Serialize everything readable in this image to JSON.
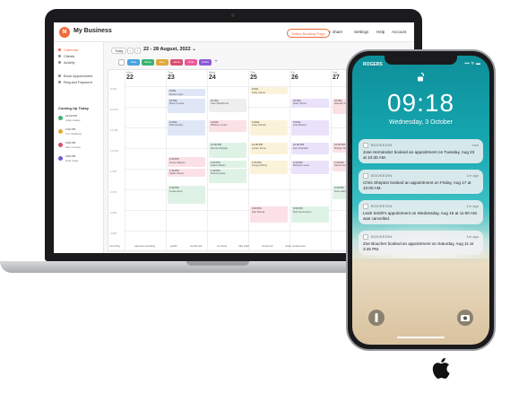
{
  "app": {
    "business_name": "My Business",
    "logo_letter": "M",
    "book_button": "Online Booking Page",
    "share_label": "< share",
    "header_links": [
      "Settings",
      "Help",
      "Account"
    ]
  },
  "sidebar": {
    "items": [
      {
        "label": "Calendar",
        "active": true
      },
      {
        "label": "Clients",
        "active": false
      },
      {
        "label": "Activity",
        "active": false
      },
      {
        "label": "Book Appointment",
        "active": false
      },
      {
        "label": "Request Payment",
        "active": false
      }
    ],
    "coming_title": "Coming Up Today",
    "coming_up": [
      {
        "time": "12:00 PM",
        "name": "Juliet Hodes",
        "color": "#3bb273"
      },
      {
        "time": "1:00 PM",
        "name": "Ann Shelberg",
        "color": "#e0a93a"
      },
      {
        "time": "3:00 PM",
        "name": "Alex Loewen",
        "color": "#d94f70"
      },
      {
        "time": "4:00 PM",
        "name": "Nina Caley",
        "color": "#6b5bd8"
      }
    ],
    "brand": "bookedin"
  },
  "toolbar": {
    "today": "Today",
    "prev": "‹",
    "next": "›",
    "date_range": "22 - 28 August, 2022 ⌄"
  },
  "staff_chips": [
    {
      "label": "Kelly",
      "color": "#4aa3df"
    },
    {
      "label": "Steve",
      "color": "#3bb273"
    },
    {
      "label": "Eve",
      "color": "#e0a93a"
    },
    {
      "label": "Jamie",
      "color": "#d94f70"
    },
    {
      "label": "Gina",
      "color": "#e85a9a"
    },
    {
      "label": "Andre",
      "color": "#8e5bd8"
    }
  ],
  "calendar": {
    "days": [
      {
        "name": "Mon",
        "date": "22"
      },
      {
        "name": "Tue",
        "date": "23"
      },
      {
        "name": "Wed",
        "date": "24"
      },
      {
        "name": "Thu",
        "date": "25"
      },
      {
        "name": "Fri",
        "date": "26"
      },
      {
        "name": "Sat",
        "date": "27"
      }
    ],
    "times": [
      "9 AM",
      "10 AM",
      "11 AM",
      "12 PM",
      "1 PM",
      "2 PM",
      "3 PM",
      "4 PM"
    ],
    "events": [
      {
        "day": 1,
        "slot": 0.1,
        "len": 0.35,
        "time": "9:00a",
        "name": "Maria Lopez",
        "color": "#dfe7f7"
      },
      {
        "day": 1,
        "slot": 0.55,
        "len": 0.75,
        "time": "10:00a",
        "name": "Brian Cooper",
        "color": "#dfe7f7"
      },
      {
        "day": 1,
        "slot": 1.6,
        "len": 0.8,
        "time": "11:00a",
        "name": "Paul Hendry",
        "color": "#dfe7f7"
      },
      {
        "day": 1,
        "slot": 3.4,
        "len": 0.5,
        "time": "1:00 PM",
        "name": "Grace Watson",
        "color": "#fbe1e6"
      },
      {
        "day": 1,
        "slot": 3.95,
        "len": 0.45,
        "time": "1:30 PM",
        "name": "Kaitlin Street",
        "color": "#fbe1e6"
      },
      {
        "day": 1,
        "slot": 4.8,
        "len": 0.9,
        "time": "2:30 PM",
        "name": "Linda Hood",
        "color": "#dff2e6"
      },
      {
        "day": 2,
        "slot": 0.55,
        "len": 0.7,
        "time": "10:00a",
        "name": "Sam Whitehurst",
        "color": "#eeeeee"
      },
      {
        "day": 2,
        "slot": 1.6,
        "len": 0.6,
        "time": "11:00a",
        "name": "Whitney Jones",
        "color": "#fbe1e6"
      },
      {
        "day": 2,
        "slot": 2.7,
        "len": 0.8,
        "time": "12:00 PM",
        "name": "Dennis Morgan",
        "color": "#dff2e6"
      },
      {
        "day": 2,
        "slot": 3.55,
        "len": 0.35,
        "time": "1:00 PM",
        "name": "Carlos Martin",
        "color": "#dff2e6"
      },
      {
        "day": 2,
        "slot": 3.95,
        "len": 0.75,
        "time": "1:30 PM",
        "name": "Debra Hooke",
        "color": "#dff2e6"
      },
      {
        "day": 3,
        "slot": 0.0,
        "len": 0.35,
        "time": "9:00a",
        "name": "Kelly James",
        "color": "#fbf3d9"
      },
      {
        "day": 3,
        "slot": 1.6,
        "len": 0.8,
        "time": "11:00a",
        "name": "Cody Garcia",
        "color": "#fbf3d9"
      },
      {
        "day": 3,
        "slot": 2.7,
        "len": 0.6,
        "time": "12:00 PM",
        "name": "Luther Stone",
        "color": "#fbf3d9"
      },
      {
        "day": 3,
        "slot": 3.55,
        "len": 0.7,
        "time": "1:00 PM",
        "name": "Gregg McKay",
        "color": "#fbf3d9"
      },
      {
        "day": 3,
        "slot": 5.8,
        "len": 0.8,
        "time": "3:00 PM",
        "name": "Kari Pascal",
        "color": "#fbe1e6"
      },
      {
        "day": 4,
        "slot": 0.55,
        "len": 0.5,
        "time": "10:00a",
        "name": "Holly Vincet",
        "color": "#eae2fa"
      },
      {
        "day": 4,
        "slot": 1.6,
        "len": 0.8,
        "time": "11:00a",
        "name": "Ana Weston",
        "color": "#eae2fa"
      },
      {
        "day": 4,
        "slot": 2.7,
        "len": 0.6,
        "time": "12:00 PM",
        "name": "Eva Chandler",
        "color": "#eae2fa"
      },
      {
        "day": 4,
        "slot": 3.55,
        "len": 0.7,
        "time": "1:00 PM",
        "name": "Michael Lucas",
        "color": "#eae2fa"
      },
      {
        "day": 4,
        "slot": 5.8,
        "len": 0.8,
        "time": "3:00 PM",
        "name": "Rob Summerton",
        "color": "#dff2e6"
      },
      {
        "day": 5,
        "slot": 0.55,
        "len": 0.8,
        "time": "10:00a",
        "name": "Hannah Foy",
        "color": "#fbe1e6"
      },
      {
        "day": 5,
        "slot": 2.7,
        "len": 0.5,
        "time": "12:00 PM",
        "name": "Bridget Stone",
        "color": "#fbe1e6"
      },
      {
        "day": 5,
        "slot": 3.55,
        "len": 0.6,
        "time": "1:00 PM",
        "name": "Sarah Avery",
        "color": "#fbe1e6"
      },
      {
        "day": 5,
        "slot": 4.8,
        "len": 0.7,
        "time": "2:30 PM",
        "name": "Nora Helms",
        "color": "#dff2e6"
      }
    ]
  },
  "legend": [
    "recurring",
    "payment pending",
    "public",
    "confirmed",
    "no show",
    "fully paid",
    "comment",
    "video conference"
  ],
  "phone": {
    "carrier": "ROGERS",
    "status": "▪▪▪ ᯤ ▬",
    "clock": "09:18",
    "date": "Wednesday, 3 October",
    "notifications": [
      {
        "app": "BOOKEDIN",
        "time": "now",
        "body": "Jose Hernández booked an appointment on Tuesday, Aug 23 at 10:30 AM."
      },
      {
        "app": "BOOKEDIN",
        "time": "1m ago",
        "body": "Chris Shepton booked an appointment on Friday, Aug 17 at 10:00 AM."
      },
      {
        "app": "BOOKEDIN",
        "time": "1m ago",
        "body": "Leah Smith's appointment on Wednesday, Aug 15 at 11:00 AM was cancelled."
      },
      {
        "app": "BOOKEDIN",
        "time": "1m ago",
        "body": "Zoe Boucher booked an appointment on Saturday, Aug 11 at 3:45 PM."
      }
    ]
  },
  "colors": {
    "accent": "#f06a3c",
    "laptop_bezel": "#1b1b1d"
  }
}
